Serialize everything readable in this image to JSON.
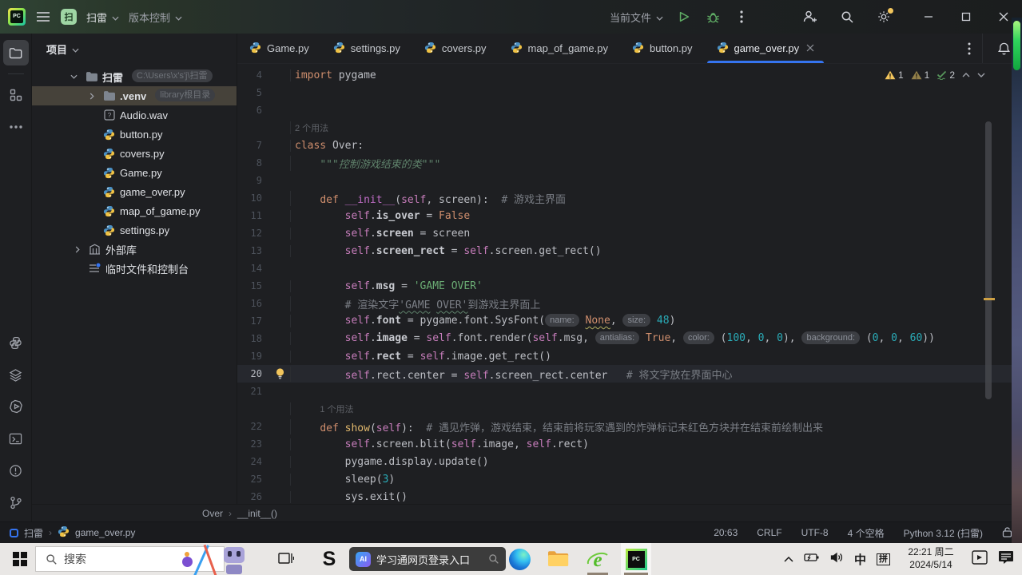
{
  "colors": {
    "accent_blue": "#3574f0",
    "run_green": "#5fad65",
    "warning_yellow": "#f2c55c",
    "selection_brown": "#46423a",
    "tab_underline": "#3574f0"
  },
  "titlebar": {
    "badge": "扫",
    "project": "扫雷",
    "vcs": "版本控制",
    "run_config": "当前文件"
  },
  "project_panel": {
    "header": "项目",
    "tree": [
      {
        "level": "pad0",
        "chevron": "down",
        "icon": "folder",
        "label": "扫雷",
        "bold": true,
        "hint": "C:\\Users\\x's'j\\扫雷",
        "selected": false
      },
      {
        "level": "pad1",
        "chevron": "right",
        "icon": "folder",
        "label": ".venv",
        "bold": true,
        "hint": "library根目录",
        "selected": true
      },
      {
        "level": "pad1",
        "chevron": "none",
        "icon": "audio",
        "label": "Audio.wav",
        "bold": false,
        "hint": "",
        "selected": false
      },
      {
        "level": "pad1",
        "chevron": "none",
        "icon": "python",
        "label": "button.py",
        "bold": false,
        "hint": "",
        "selected": false
      },
      {
        "level": "pad1",
        "chevron": "none",
        "icon": "python",
        "label": "covers.py",
        "bold": false,
        "hint": "",
        "selected": false
      },
      {
        "level": "pad1",
        "chevron": "none",
        "icon": "python",
        "label": "Game.py",
        "bold": false,
        "hint": "",
        "selected": false
      },
      {
        "level": "pad1",
        "chevron": "none",
        "icon": "python",
        "label": "game_over.py",
        "bold": false,
        "hint": "",
        "selected": false
      },
      {
        "level": "pad1",
        "chevron": "none",
        "icon": "python",
        "label": "map_of_game.py",
        "bold": false,
        "hint": "",
        "selected": false
      },
      {
        "level": "pad1",
        "chevron": "none",
        "icon": "python",
        "label": "settings.py",
        "bold": false,
        "hint": "",
        "selected": false
      },
      {
        "level": "padb",
        "chevron": "right",
        "icon": "lib",
        "label": "外部库",
        "bold": false,
        "hint": "",
        "selected": false
      },
      {
        "level": "padb",
        "chevron": "none",
        "icon": "scratch",
        "label": "临时文件和控制台",
        "bold": false,
        "hint": "",
        "selected": false
      }
    ]
  },
  "tabs": {
    "items": [
      {
        "label": "Game.py",
        "active": false
      },
      {
        "label": "settings.py",
        "active": false
      },
      {
        "label": "covers.py",
        "active": false
      },
      {
        "label": "map_of_game.py",
        "active": false
      },
      {
        "label": "button.py",
        "active": false
      },
      {
        "label": "game_over.py",
        "active": true
      }
    ]
  },
  "inspections": {
    "warn_strong": "1",
    "warn_weak": "1",
    "ok": "2"
  },
  "editor": {
    "lines": [
      {
        "num": "4",
        "segs": [
          [
            "import",
            "kw"
          ],
          [
            " pygame",
            "pl"
          ]
        ]
      },
      {
        "num": "5",
        "segs": []
      },
      {
        "num": "6",
        "segs": []
      },
      {
        "inlay": "2 个用法",
        "pad": ""
      },
      {
        "num": "7",
        "segs": [
          [
            "class",
            "kw"
          ],
          [
            " Over:",
            "pl"
          ]
        ]
      },
      {
        "num": "8",
        "segs": [
          [
            "    ",
            ""
          ],
          [
            "\"\"\"控制游戏结束的类\"\"\"",
            "doc"
          ]
        ]
      },
      {
        "num": "9",
        "segs": []
      },
      {
        "num": "10",
        "segs": [
          [
            "    ",
            ""
          ],
          [
            "def ",
            "kw"
          ],
          [
            "__init__",
            "magic"
          ],
          [
            "(",
            "pl"
          ],
          [
            "self",
            "self"
          ],
          [
            ", screen):",
            "pl"
          ],
          [
            "  # 游戏主界面",
            "cmt"
          ]
        ]
      },
      {
        "num": "11",
        "segs": [
          [
            "        ",
            ""
          ],
          [
            "self",
            "self"
          ],
          [
            ".",
            "pl"
          ],
          [
            "is_over",
            "attr"
          ],
          [
            " = ",
            "pl"
          ],
          [
            "False",
            "kw"
          ]
        ]
      },
      {
        "num": "12",
        "segs": [
          [
            "        ",
            ""
          ],
          [
            "self",
            "self"
          ],
          [
            ".",
            "pl"
          ],
          [
            "screen",
            "attr"
          ],
          [
            " = screen",
            "pl"
          ]
        ]
      },
      {
        "num": "13",
        "segs": [
          [
            "        ",
            ""
          ],
          [
            "self",
            "self"
          ],
          [
            ".",
            "pl"
          ],
          [
            "screen_rect",
            "attr"
          ],
          [
            " = ",
            "pl"
          ],
          [
            "self",
            "self"
          ],
          [
            ".screen.get_rect()",
            "pl"
          ]
        ]
      },
      {
        "num": "14",
        "segs": []
      },
      {
        "num": "15",
        "segs": [
          [
            "        ",
            ""
          ],
          [
            "self",
            "self"
          ],
          [
            ".",
            "pl"
          ],
          [
            "msg",
            "attr"
          ],
          [
            " = ",
            "pl"
          ],
          [
            "'GAME OVER'",
            "str"
          ]
        ]
      },
      {
        "num": "16",
        "segs": [
          [
            "        ",
            ""
          ],
          [
            "# 渲染文字",
            "cmt"
          ],
          [
            "'GAME",
            "cmt sq"
          ],
          [
            " ",
            "cmt"
          ],
          [
            "OVER'",
            "cmt sq"
          ],
          [
            "到游戏主界面上",
            "cmt"
          ]
        ]
      },
      {
        "num": "17",
        "segs": [
          [
            "        ",
            ""
          ],
          [
            "self",
            "self"
          ],
          [
            ".",
            "pl"
          ],
          [
            "font",
            "attr"
          ],
          [
            " = pygame.font.SysFont(",
            "pl"
          ],
          [
            "name:",
            "hint"
          ],
          [
            " ",
            ""
          ],
          [
            "None",
            "kw warn"
          ],
          [
            ", ",
            "pl"
          ],
          [
            "size:",
            "hint"
          ],
          [
            " ",
            ""
          ],
          [
            "48",
            "num"
          ],
          [
            ")",
            "pl"
          ]
        ]
      },
      {
        "num": "18",
        "segs": [
          [
            "        ",
            ""
          ],
          [
            "self",
            "self"
          ],
          [
            ".",
            "pl"
          ],
          [
            "image",
            "attr"
          ],
          [
            " = ",
            "pl"
          ],
          [
            "self",
            "self"
          ],
          [
            ".font.render(",
            "pl"
          ],
          [
            "self",
            "self"
          ],
          [
            ".msg, ",
            "pl"
          ],
          [
            "antialias:",
            "hint"
          ],
          [
            " ",
            ""
          ],
          [
            "True",
            "kw"
          ],
          [
            ", ",
            "pl"
          ],
          [
            "color:",
            "hint"
          ],
          [
            " (",
            "pl"
          ],
          [
            "100",
            "num"
          ],
          [
            ", ",
            "pl"
          ],
          [
            "0",
            "num"
          ],
          [
            ", ",
            "pl"
          ],
          [
            "0",
            "num"
          ],
          [
            "), ",
            "pl"
          ],
          [
            "background:",
            "hint"
          ],
          [
            " (",
            "pl"
          ],
          [
            "0",
            "num"
          ],
          [
            ", ",
            "pl"
          ],
          [
            "0",
            "num"
          ],
          [
            ", ",
            "pl"
          ],
          [
            "60",
            "num"
          ],
          [
            "))",
            "pl"
          ]
        ]
      },
      {
        "num": "19",
        "segs": [
          [
            "        ",
            ""
          ],
          [
            "self",
            "self"
          ],
          [
            ".",
            "pl"
          ],
          [
            "rect",
            "attr"
          ],
          [
            " = ",
            "pl"
          ],
          [
            "self",
            "self"
          ],
          [
            ".image.get_rect()",
            "pl"
          ]
        ]
      },
      {
        "num": "20",
        "current": true,
        "bulb": true,
        "segs": [
          [
            "        ",
            ""
          ],
          [
            "self",
            "self"
          ],
          [
            ".rect.center = ",
            "pl"
          ],
          [
            "self",
            "self"
          ],
          [
            ".screen_rect.center",
            "pl"
          ],
          [
            "   # 将文字放在界面中心",
            "cmt"
          ]
        ]
      },
      {
        "num": "21",
        "segs": []
      },
      {
        "inlay": "1 个用法",
        "pad": "    "
      },
      {
        "num": "22",
        "segs": [
          [
            "    ",
            ""
          ],
          [
            "def ",
            "kw"
          ],
          [
            "show",
            "fn"
          ],
          [
            "(",
            "pl"
          ],
          [
            "self",
            "self"
          ],
          [
            "):",
            "pl"
          ],
          [
            "  # 遇见炸弹，游戏结束，结束前将玩家遇到的炸弹标记未红色方块并在结束前绘制出来",
            "cmt"
          ]
        ]
      },
      {
        "num": "23",
        "segs": [
          [
            "        ",
            ""
          ],
          [
            "self",
            "self"
          ],
          [
            ".screen.blit(",
            "pl"
          ],
          [
            "self",
            "self"
          ],
          [
            ".image, ",
            "pl"
          ],
          [
            "self",
            "self"
          ],
          [
            ".rect)",
            "pl"
          ]
        ]
      },
      {
        "num": "24",
        "segs": [
          [
            "        ",
            ""
          ],
          [
            "pygame.display.update()",
            "pl"
          ]
        ]
      },
      {
        "num": "25",
        "segs": [
          [
            "        ",
            ""
          ],
          [
            "sleep(",
            "pl"
          ],
          [
            "3",
            "num"
          ],
          [
            ")",
            "pl"
          ]
        ]
      },
      {
        "num": "26",
        "segs": [
          [
            "        ",
            ""
          ],
          [
            "sys.exit()",
            "pl"
          ]
        ]
      }
    ]
  },
  "navbar": {
    "class_name": "Over",
    "member": "__init__()"
  },
  "statusbar": {
    "project": "扫雷",
    "file": "game_over.py",
    "position": "20:63",
    "line_sep": "CRLF",
    "encoding": "UTF-8",
    "indent": "4 个空格",
    "interpreter": "Python 3.12 (扫雷)"
  },
  "taskbar": {
    "search_placeholder": "搜索",
    "widget_badge": "AI",
    "widget_text": "学习通网页登录入口",
    "ime": "中",
    "ime_mode": "拼",
    "time": "22:21 周二",
    "date": "2024/5/14"
  }
}
